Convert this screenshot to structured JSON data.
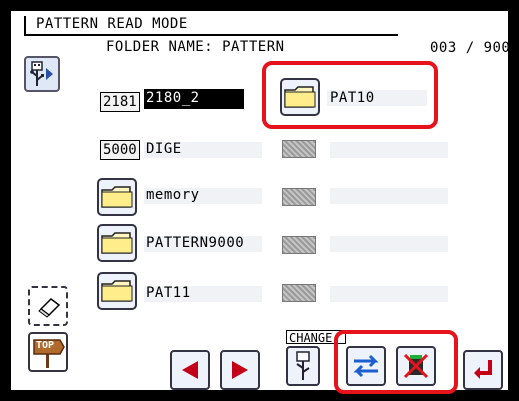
{
  "header": {
    "mode_title": "PATTERN READ MODE",
    "folder_label": "FOLDER NAME: PATTERN",
    "counter": "003 / 900"
  },
  "left_list": [
    {
      "number": "2181",
      "name": "2180_2",
      "selected": true
    },
    {
      "number": "5000",
      "name": "DIGE"
    },
    {
      "type": "folder",
      "name": "memory"
    },
    {
      "type": "folder",
      "name": "PATTERN9000"
    },
    {
      "type": "folder",
      "name": "PAT11"
    }
  ],
  "right_list": [
    {
      "type": "folder",
      "name": "PAT10"
    }
  ],
  "toolbar": {
    "change_label": "CHANGE",
    "top_label": "TOP"
  },
  "colors": {
    "highlight": "#e6121c",
    "arrow": "#c40018",
    "swap": "#1b5fd0"
  },
  "icons": {
    "usb": "usb-icon",
    "folder": "folder-icon",
    "eraser": "eraser-icon",
    "swap": "swap-icon",
    "delete": "delete-icon",
    "enter": "enter-icon"
  }
}
